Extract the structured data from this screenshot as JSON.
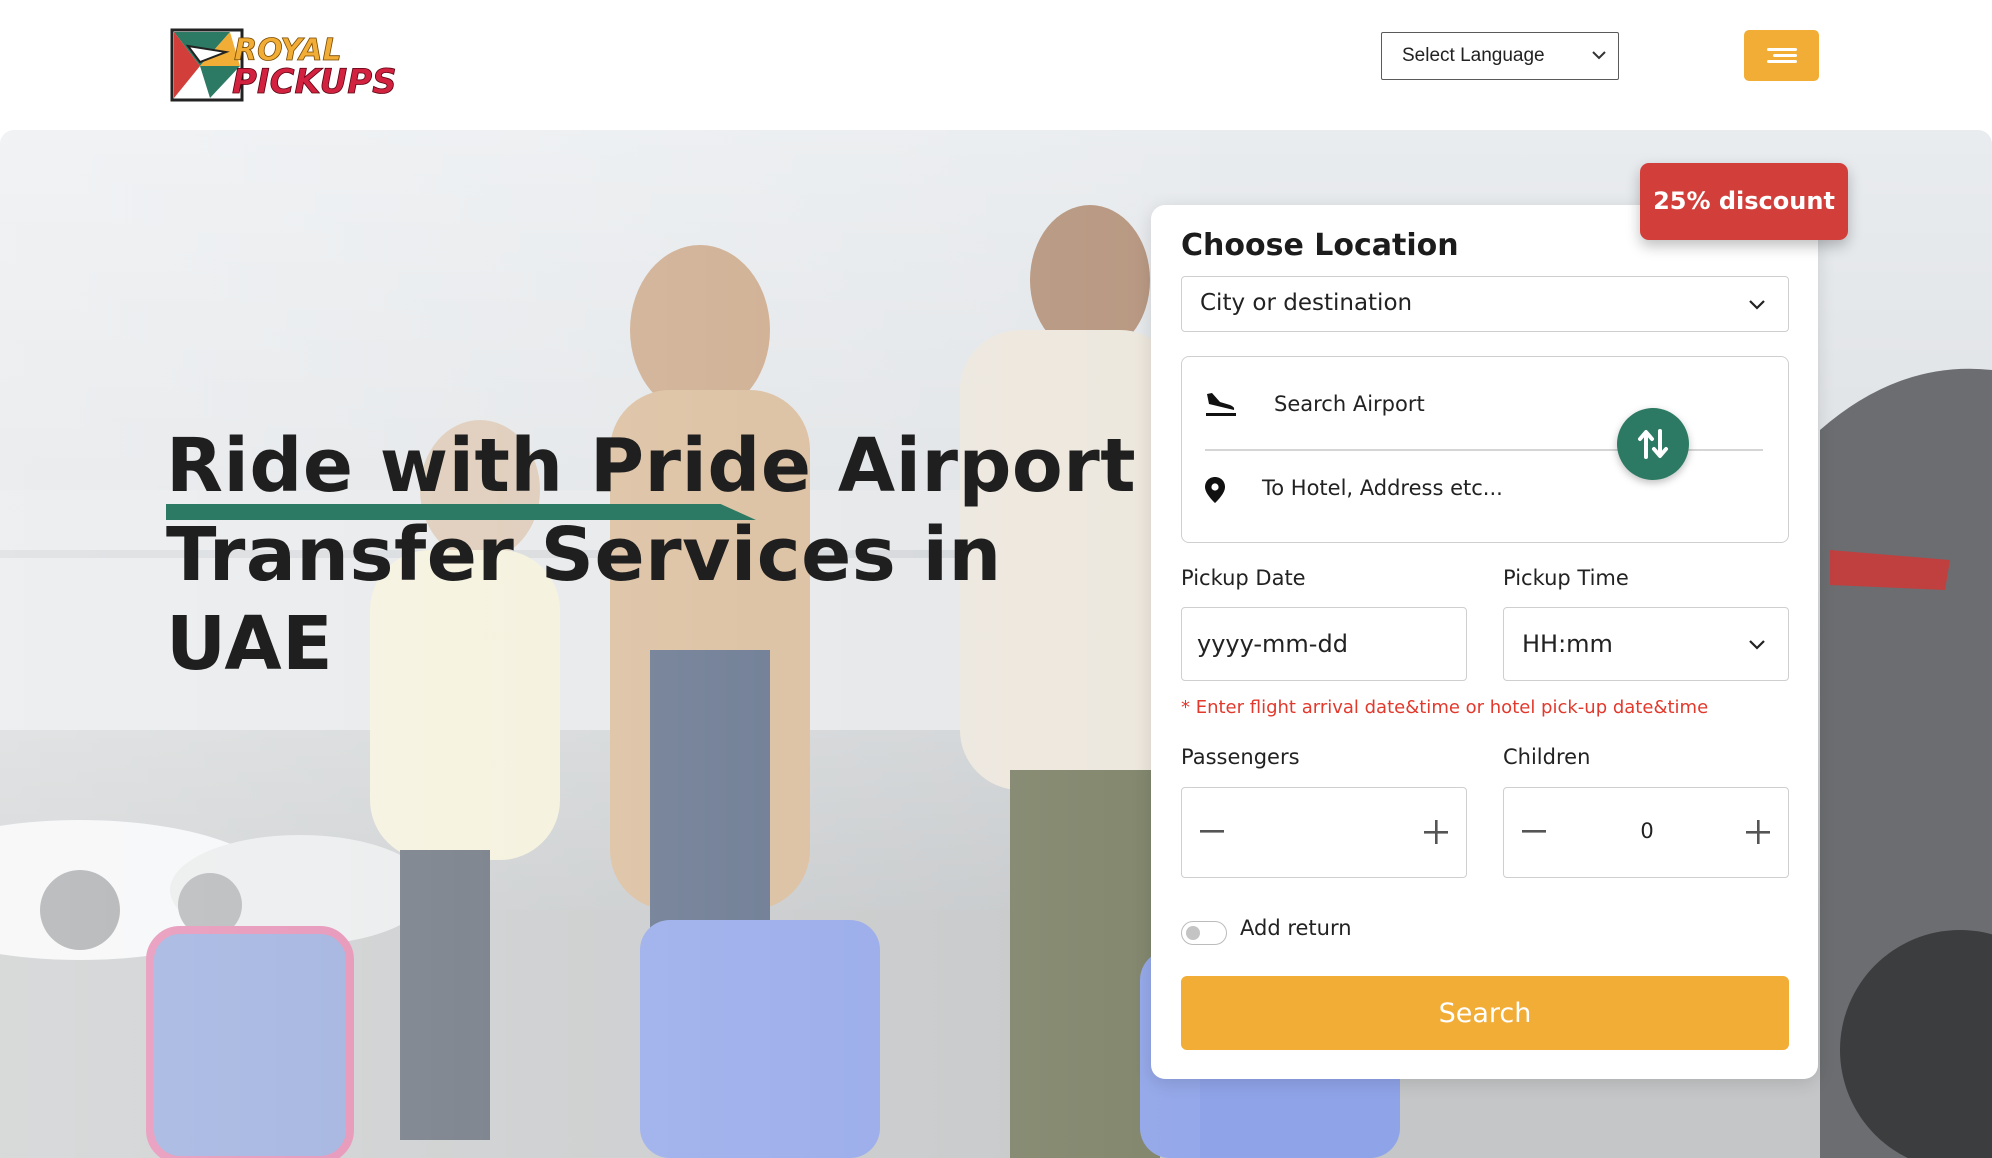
{
  "header": {
    "logo_text_top": "ROYAL",
    "logo_text_bottom": "PICKUPS",
    "language_select": "Select Language",
    "menu_icon": "hamburger-icon"
  },
  "hero": {
    "title": "Ride with Pride Airport Transfer Services in UAE"
  },
  "booking": {
    "discount_badge": "25% discount",
    "choose_location_label": "Choose Location",
    "location_select": "City or destination",
    "from_placeholder": "Search Airport",
    "to_placeholder": "To Hotel, Address etc...",
    "pickup_date_label": "Pickup Date",
    "pickup_date_placeholder": "yyyy-mm-dd",
    "pickup_time_label": "Pickup Time",
    "pickup_time_value": "HH:mm",
    "hint": "* Enter flight arrival date&time or hotel pick-up date&time",
    "passengers_label": "Passengers",
    "passengers_value": "",
    "children_label": "Children",
    "children_value": "0",
    "add_return_label": "Add return",
    "search_button": "Search"
  },
  "colors": {
    "accent_orange": "#f1ad35",
    "brand_green": "#2c7a63",
    "discount_red": "#d23f3a",
    "hint_red": "#e2392c"
  }
}
